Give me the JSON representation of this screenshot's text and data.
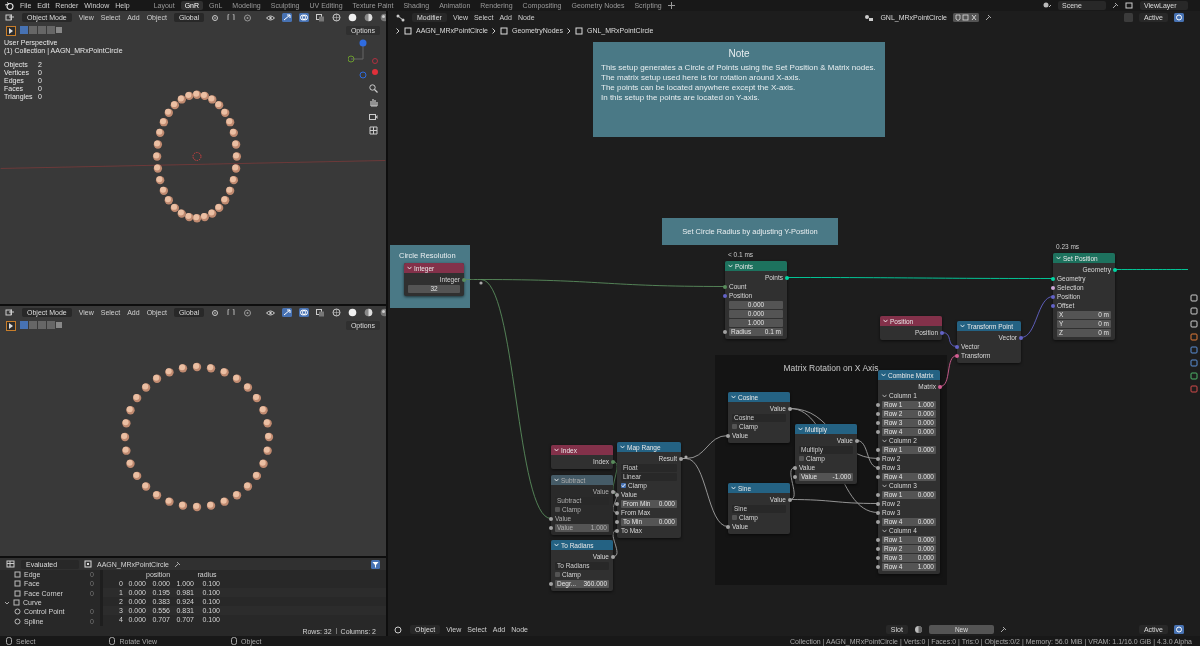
{
  "menu": [
    "File",
    "Edit",
    "Render",
    "Window",
    "Help"
  ],
  "workspaces": [
    {
      "label": "Layout",
      "selected": false
    },
    {
      "label": "GnR",
      "selected": true
    },
    {
      "label": "GnL",
      "selected": false
    },
    {
      "label": "Modeling",
      "selected": false
    },
    {
      "label": "Sculpting",
      "selected": false
    },
    {
      "label": "UV Editing",
      "selected": false
    },
    {
      "label": "Texture Paint",
      "selected": false
    },
    {
      "label": "Shading",
      "selected": false
    },
    {
      "label": "Animation",
      "selected": false
    },
    {
      "label": "Rendering",
      "selected": false
    },
    {
      "label": "Compositing",
      "selected": false
    },
    {
      "label": "Geometry Nodes",
      "selected": false
    },
    {
      "label": "Scripting",
      "selected": false
    }
  ],
  "scene": "Scene",
  "view_layer": "ViewLayer",
  "viewport_top": {
    "mode": "Object Mode",
    "menus": [
      "View",
      "Select",
      "Add",
      "Object"
    ],
    "orientation": "Global",
    "options": "Options",
    "view_name": "User Perspective",
    "collection": "(1) Collection | AAGN_MRxPointCircle",
    "stats": [
      {
        "label": "Objects",
        "value": "2"
      },
      {
        "label": "Vertices",
        "value": "0"
      },
      {
        "label": "Edges",
        "value": "0"
      },
      {
        "label": "Faces",
        "value": "0"
      },
      {
        "label": "Triangles",
        "value": "0"
      }
    ]
  },
  "viewport_bottom": {
    "mode": "Object Mode",
    "menus": [
      "View",
      "Select",
      "Add",
      "Object"
    ],
    "orientation": "Global",
    "options": "Options"
  },
  "spreadsheet": {
    "mode": "Evaluated",
    "object": "AAGN_MRxPointCircle",
    "tree": [
      {
        "label": "Edge",
        "count": "0"
      },
      {
        "label": "Face",
        "count": "0"
      },
      {
        "label": "Face Corner",
        "count": "0"
      },
      {
        "label": "Curve",
        "expanded": true,
        "children": [
          {
            "label": "Control Point",
            "count": "0"
          },
          {
            "label": "Spline",
            "count": "0"
          }
        ]
      }
    ],
    "columns": [
      "",
      "position",
      "",
      "radius"
    ],
    "rows": [
      {
        "index": "0",
        "cells": [
          "0.000",
          "0.000",
          "1.000",
          "0.100"
        ]
      },
      {
        "index": "1",
        "cells": [
          "0.000",
          "0.195",
          "0.981",
          "0.100"
        ]
      },
      {
        "index": "2",
        "cells": [
          "0.000",
          "0.383",
          "0.924",
          "0.100"
        ]
      },
      {
        "index": "3",
        "cells": [
          "0.000",
          "0.556",
          "0.831",
          "0.100"
        ]
      },
      {
        "index": "4",
        "cells": [
          "0.000",
          "0.707",
          "0.707",
          "0.100"
        ]
      }
    ],
    "rows_count": "Rows: 32",
    "columns_count": "Columns: 2"
  },
  "node_editor": {
    "context": "Modifier",
    "menus": [
      "View",
      "Select",
      "Add",
      "Node"
    ],
    "node_group": "GNL_MRxPointCircle",
    "active": "Active",
    "breadcrumbs": [
      "AAGN_MRxPointCircle",
      "GeometryNodes",
      "GNL_MRxPointCircle"
    ],
    "frames": [
      {
        "kind": "note",
        "label": "Note",
        "lines": [
          "This setup generates a Circle of Points using the Set Position & Matrix nodes.",
          "The matrix setup used here is for rotation around X-axis.",
          "The points can be located anywhere except the X-axis.",
          "In this setup the points are located on Y-axis."
        ]
      },
      {
        "kind": "label",
        "label": "Set Circle Radius by adjusting Y-Position"
      },
      {
        "kind": "group",
        "label": "Circle Resolution"
      },
      {
        "kind": "dark",
        "label": "Matrix Rotation on X Axis"
      }
    ],
    "nodes": [
      {
        "title": "Integer",
        "kind": "input",
        "muted": false,
        "rows": [
          {
            "kind": "output",
            "label": "Integer",
            "color": "#598c5c"
          },
          {
            "kind": "vector",
            "value": "32"
          }
        ]
      },
      {
        "title": "Points",
        "kind": "geometry",
        "muted": false,
        "timing": "< 0.1 ms",
        "rows": [
          {
            "kind": "output",
            "label": "Points",
            "color": "#00d6a3"
          },
          {
            "kind": "input",
            "label": "Count",
            "color": "#598c5c"
          },
          {
            "kind": "input",
            "label": "Position",
            "color": "#6363c7"
          },
          {
            "kind": "vector",
            "value": "0.000"
          },
          {
            "kind": "vector",
            "value": "0.000"
          },
          {
            "kind": "vector",
            "value": "1.000"
          },
          {
            "kind": "field",
            "label": "Radius",
            "value": "0.1 m",
            "color": "#a1a1a1"
          }
        ]
      },
      {
        "title": "Position",
        "kind": "input",
        "muted": false,
        "rows": [
          {
            "kind": "output",
            "label": "Position",
            "color": "#6363c7"
          }
        ]
      },
      {
        "title": "Transform Point",
        "kind": "converter",
        "muted": false,
        "rows": [
          {
            "kind": "output",
            "label": "Vector",
            "color": "#6363c7"
          },
          {
            "kind": "input",
            "label": "Vector",
            "color": "#6363c7"
          },
          {
            "kind": "input",
            "label": "Transform",
            "color": "#d35d92"
          }
        ]
      },
      {
        "title": "Set Position",
        "kind": "geometry",
        "muted": false,
        "timing": "0.23 ms",
        "rows": [
          {
            "kind": "output",
            "label": "Geometry",
            "color": "#00d6a3"
          },
          {
            "kind": "input",
            "label": "Geometry",
            "color": "#00d6a3"
          },
          {
            "kind": "input",
            "label": "Selection",
            "color": "#cca6d6"
          },
          {
            "kind": "input",
            "label": "Position",
            "color": "#6363c7"
          },
          {
            "kind": "input",
            "label": "Offset",
            "color": "#6363c7"
          },
          {
            "kind": "field",
            "label": "X",
            "value": "0 m"
          },
          {
            "kind": "field",
            "label": "Y",
            "value": "0 m"
          },
          {
            "kind": "field",
            "label": "Z",
            "value": "0 m"
          }
        ]
      },
      {
        "title": "Combine Matrix",
        "kind": "converter",
        "muted": false,
        "rows": [
          {
            "kind": "output",
            "label": "Matrix",
            "color": "#d35d92"
          },
          {
            "kind": "panel",
            "label": "Column 1"
          },
          {
            "kind": "field",
            "label": "Row 1",
            "value": "1.000",
            "color": "#a1a1a1"
          },
          {
            "kind": "field",
            "label": "Row 2",
            "value": "0.000",
            "color": "#a1a1a1"
          },
          {
            "kind": "field",
            "label": "Row 3",
            "value": "0.000",
            "color": "#a1a1a1"
          },
          {
            "kind": "field",
            "label": "Row 4",
            "value": "0.000",
            "color": "#a1a1a1"
          },
          {
            "kind": "panel",
            "label": "Column 2"
          },
          {
            "kind": "field",
            "label": "Row 1",
            "value": "0.000",
            "color": "#a1a1a1"
          },
          {
            "kind": "input",
            "label": "Row 2",
            "color": "#a1a1a1"
          },
          {
            "kind": "input",
            "label": "Row 3",
            "color": "#a1a1a1"
          },
          {
            "kind": "field",
            "label": "Row 4",
            "value": "0.000",
            "color": "#a1a1a1"
          },
          {
            "kind": "panel",
            "label": "Column 3"
          },
          {
            "kind": "field",
            "label": "Row 1",
            "value": "0.000",
            "color": "#a1a1a1"
          },
          {
            "kind": "input",
            "label": "Row 2",
            "color": "#a1a1a1"
          },
          {
            "kind": "input",
            "label": "Row 3",
            "color": "#a1a1a1"
          },
          {
            "kind": "field",
            "label": "Row 4",
            "value": "0.000",
            "color": "#a1a1a1"
          },
          {
            "kind": "panel",
            "label": "Column 4"
          },
          {
            "kind": "field",
            "label": "Row 1",
            "value": "0.000",
            "color": "#a1a1a1"
          },
          {
            "kind": "field",
            "label": "Row 2",
            "value": "0.000",
            "color": "#a1a1a1"
          },
          {
            "kind": "field",
            "label": "Row 3",
            "value": "0.000",
            "color": "#a1a1a1"
          },
          {
            "kind": "field",
            "label": "Row 4",
            "value": "1.000",
            "color": "#a1a1a1"
          }
        ]
      },
      {
        "title": "Cosine",
        "kind": "converter",
        "muted": false,
        "rows": [
          {
            "kind": "output",
            "label": "Value",
            "color": "#a1a1a1"
          },
          {
            "kind": "dropdown",
            "value": "Cosine"
          },
          {
            "kind": "checkbox",
            "label": "Clamp",
            "checked": false
          },
          {
            "kind": "input",
            "label": "Value",
            "color": "#a1a1a1"
          }
        ]
      },
      {
        "title": "Index",
        "kind": "input",
        "muted": false,
        "rows": [
          {
            "kind": "output",
            "label": "Index",
            "color": "#598c5c"
          }
        ]
      },
      {
        "title": "Subtract",
        "kind": "converter",
        "muted": true,
        "rows": [
          {
            "kind": "output",
            "label": "Value",
            "color": "#a1a1a1"
          },
          {
            "kind": "dropdown",
            "value": "Subtract"
          },
          {
            "kind": "checkbox",
            "label": "Clamp",
            "checked": false
          },
          {
            "kind": "input",
            "label": "Value",
            "color": "#a1a1a1"
          },
          {
            "kind": "field",
            "label": "Value",
            "value": "1.000",
            "color": "#a1a1a1"
          }
        ]
      },
      {
        "title": "Map Range",
        "kind": "converter",
        "muted": false,
        "rows": [
          {
            "kind": "output",
            "label": "Result",
            "color": "#a1a1a1"
          },
          {
            "kind": "dropdown",
            "value": "Float"
          },
          {
            "kind": "dropdown",
            "value": "Linear"
          },
          {
            "kind": "checkbox",
            "label": "Clamp",
            "checked": true
          },
          {
            "kind": "input",
            "label": "Value",
            "color": "#a1a1a1"
          },
          {
            "kind": "field",
            "label": "From Min",
            "value": "0.000",
            "color": "#a1a1a1"
          },
          {
            "kind": "input",
            "label": "From Max",
            "color": "#a1a1a1"
          },
          {
            "kind": "field",
            "label": "To Min",
            "value": "0.000",
            "color": "#a1a1a1"
          },
          {
            "kind": "input",
            "label": "To Max",
            "color": "#a1a1a1"
          }
        ]
      },
      {
        "title": "Sine",
        "kind": "converter",
        "muted": false,
        "rows": [
          {
            "kind": "output",
            "label": "Value",
            "color": "#a1a1a1"
          },
          {
            "kind": "dropdown",
            "value": "Sine"
          },
          {
            "kind": "checkbox",
            "label": "Clamp",
            "checked": false
          },
          {
            "kind": "input",
            "label": "Value",
            "color": "#a1a1a1"
          }
        ]
      },
      {
        "title": "Multiply",
        "kind": "converter",
        "muted": false,
        "rows": [
          {
            "kind": "output",
            "label": "Value",
            "color": "#a1a1a1"
          },
          {
            "kind": "dropdown",
            "value": "Multiply"
          },
          {
            "kind": "checkbox",
            "label": "Clamp",
            "checked": false
          },
          {
            "kind": "input",
            "label": "Value",
            "color": "#a1a1a1"
          },
          {
            "kind": "field",
            "label": "Value",
            "value": "-1.000",
            "color": "#a1a1a1"
          }
        ]
      },
      {
        "title": "To Radians",
        "kind": "converter",
        "muted": false,
        "rows": [
          {
            "kind": "output",
            "label": "Value",
            "color": "#a1a1a1"
          },
          {
            "kind": "dropdown",
            "value": "To Radians"
          },
          {
            "kind": "checkbox",
            "label": "Clamp",
            "checked": false
          },
          {
            "kind": "field",
            "label": "Degr...",
            "value": "360.000",
            "color": "#a1a1a1"
          }
        ]
      }
    ],
    "footer": {
      "object": "Object",
      "menus": [
        "View",
        "Select",
        "Add",
        "Node"
      ],
      "slot": "Slot",
      "new": "New",
      "active": "Active"
    }
  },
  "status_bar": {
    "hints": [
      "Select",
      "Rotate View",
      "Object"
    ],
    "info": "Collection | AAGN_MRxPointCircle | Verts:0 | Faces:0 | Tris:0 | Objects:0/2 | Memory: 56.0 MiB | VRAM: 1.1/16.0 GiB | 4.3.0 Alpha"
  }
}
